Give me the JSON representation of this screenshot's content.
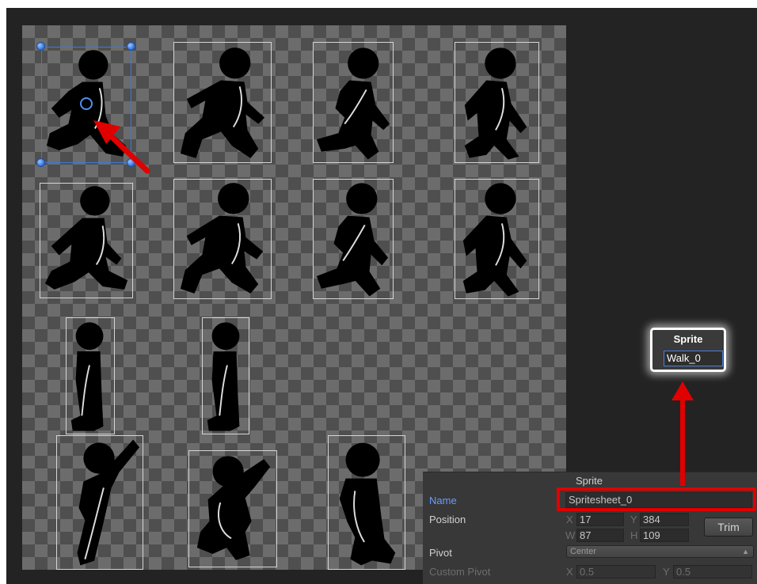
{
  "colors": {
    "annotation_red": "#e00000",
    "selection_blue": "#3f78d8",
    "name_label_blue": "#6a9cff",
    "panel_bg": "#383838"
  },
  "sprite_popup": {
    "title": "Sprite",
    "name_value": "Walk_0"
  },
  "inspector": {
    "header": "Sprite",
    "name_label": "Name",
    "name_value": "Spritesheet_0",
    "position_label": "Position",
    "x_label": "X",
    "x_value": "17",
    "y_label": "Y",
    "y_value": "384",
    "w_label": "W",
    "w_value": "87",
    "h_label": "H",
    "h_value": "109",
    "trim_label": "Trim",
    "pivot_label": "Pivot",
    "pivot_value": "Center",
    "custom_pivot_label": "Custom Pivot",
    "custom_x_label": "X",
    "custom_x_value": "0.5",
    "custom_y_label": "Y",
    "custom_y_value": "0.5"
  },
  "frames": {
    "pose_icons": [
      "walk-pose-1-icon",
      "walk-pose-2-icon",
      "walk-pose-3-icon",
      "walk-pose-4-icon",
      "walk-pose-5-icon",
      "walk-pose-6-icon",
      "walk-pose-7-icon",
      "walk-pose-8-icon",
      "stand-pose-1-icon",
      "stand-pose-2-icon",
      "jump-reach-icon",
      "crouch-pose-icon",
      "stand-back-icon"
    ]
  }
}
